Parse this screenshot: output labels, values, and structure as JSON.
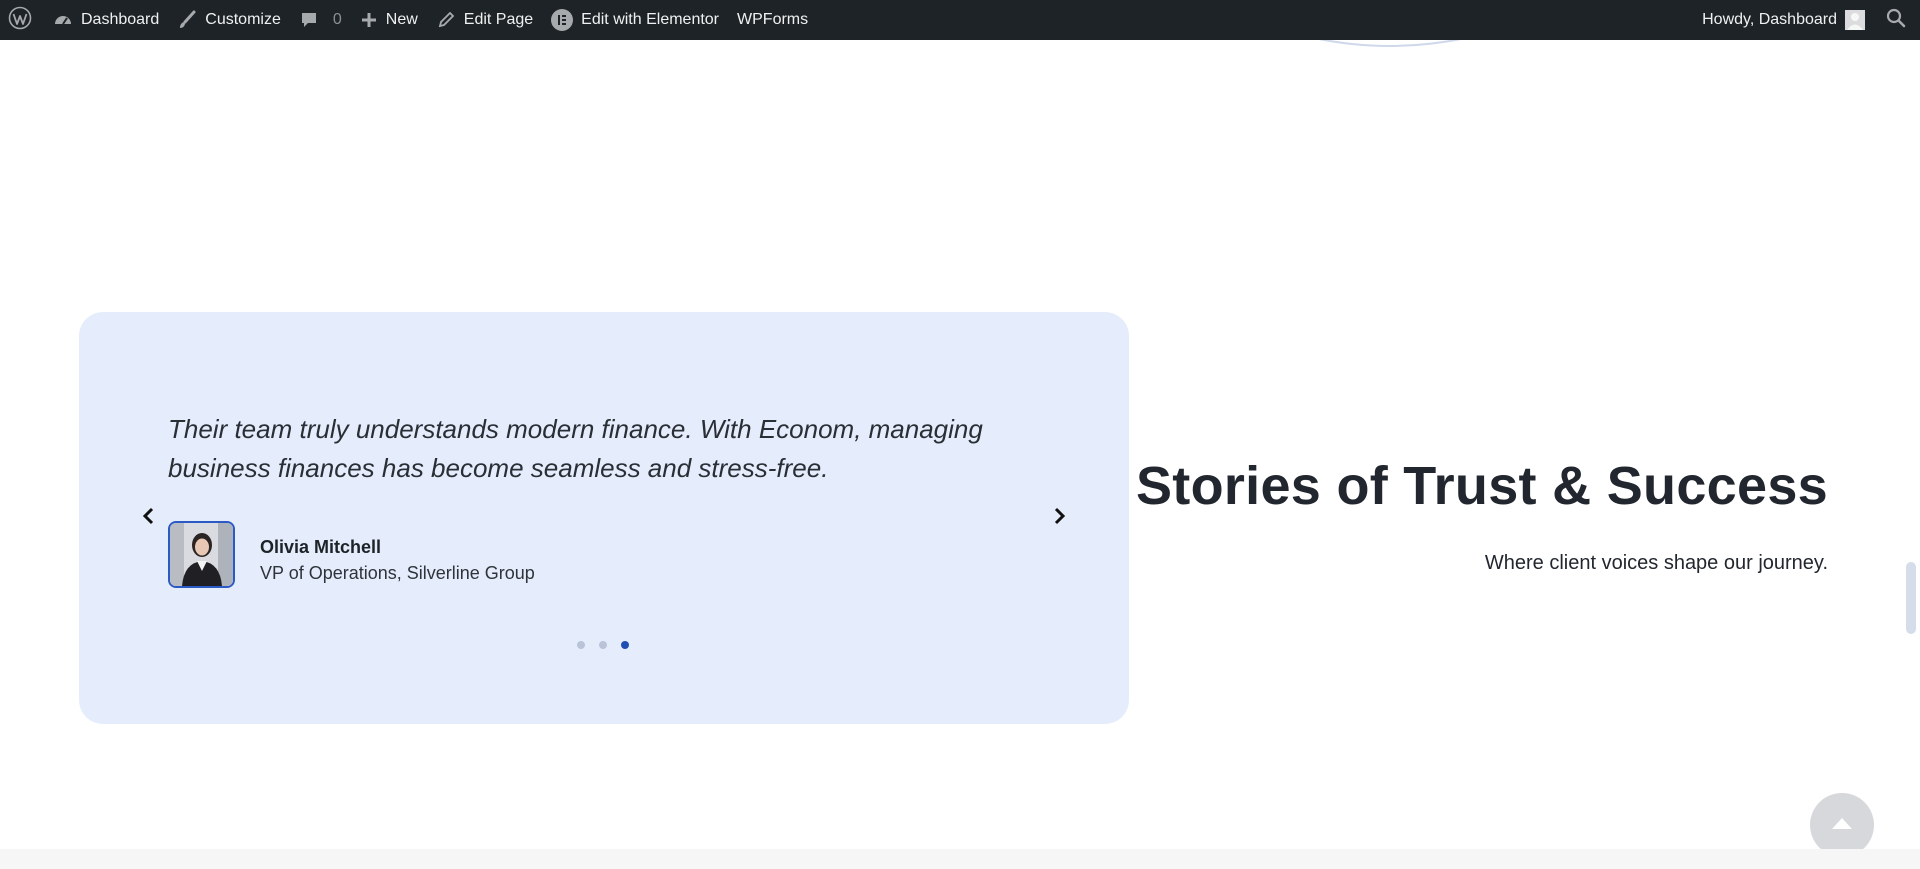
{
  "adminbar": {
    "items": [
      {
        "label": "Dashboard",
        "icon": "dashboard-icon"
      },
      {
        "label": "Customize",
        "icon": "brush-icon"
      },
      {
        "label": "",
        "icon": "comment-icon",
        "count": "0"
      },
      {
        "label": "New",
        "icon": "plus-icon"
      },
      {
        "label": "Edit Page",
        "icon": "pencil-icon"
      },
      {
        "label": "Edit with Elementor",
        "icon": "elementor-icon"
      },
      {
        "label": "WPForms"
      }
    ],
    "howdy": "Howdy, Dashboard"
  },
  "testimonial": {
    "quote": "Their team truly understands modern finance. With Econom, managing business finances has become seamless and stress-free.",
    "author_name": "Olivia Mitchell",
    "author_role": "VP of Operations, Silverline Group",
    "slides_total": 3,
    "active_slide": 3
  },
  "section": {
    "heading": "Stories of Trust & Success",
    "subheading": "Where client voices shape our journey."
  },
  "colors": {
    "adminbar_bg": "#1d2327",
    "card_bg": "#e5edfc",
    "dot_active": "#1f4fb3",
    "dot_inactive": "#b9c4d8"
  }
}
